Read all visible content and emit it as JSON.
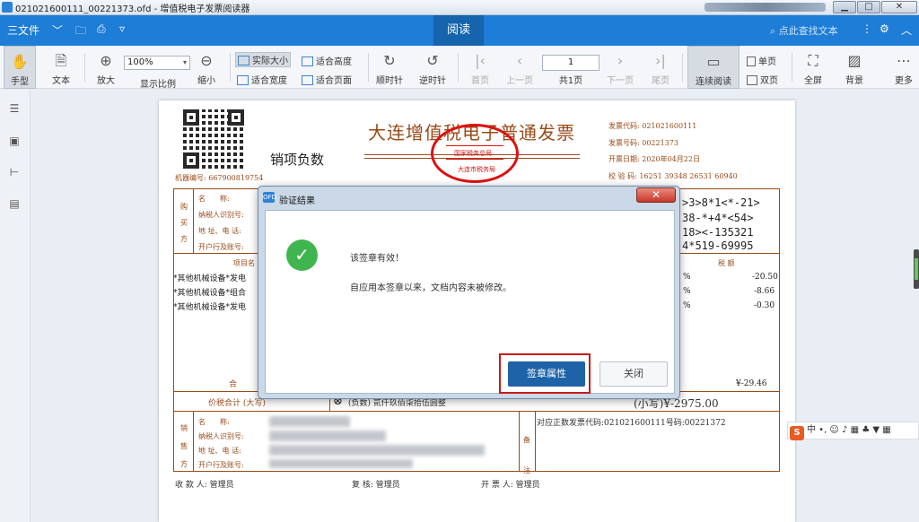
{
  "window": {
    "title": "021021600111_00221373.ofd - 增值税电子发票阅读器"
  },
  "menubar": {
    "file_label": "三文件",
    "read_tab": "阅读",
    "search_placeholder": "点此查找文本"
  },
  "toolbar": {
    "hand": "手型",
    "text": "文本",
    "zoom_in": "放大",
    "zoom_value": "100%",
    "display_ratio": "显示比例",
    "zoom_out": "缩小",
    "actual_size": "实际大小",
    "fit_height": "适合高度",
    "fit_width": "适合宽度",
    "fit_page": "适合页面",
    "rotate_cw": "顺时针",
    "rotate_ccw": "逆时针",
    "first_page": "首页",
    "prev_page": "上一页",
    "page_current": "1",
    "page_total": "共1页",
    "next_page": "下一页",
    "last_page": "尾页",
    "continuous": "连续阅读",
    "single_page": "单页",
    "double_page": "双页",
    "fullscreen": "全屏",
    "background": "背景",
    "more": "更多"
  },
  "invoice": {
    "title": "大连增值税电子普通发票",
    "sales_negative": "销项负数",
    "machine_no": "机器编号: 667900819754",
    "code_label": "发票代码: 021021600111",
    "number_label": "发票号码: 00221373",
    "date_label": "开票日期: 2020年04月22日",
    "check_label": "校 验 码: 16251 39348 26531 60940",
    "stamp_top": "国家税务总局",
    "stamp_bottom": "大连市税务局",
    "buyer_side": [
      "购",
      "买",
      "方"
    ],
    "buyer_fields": [
      "名　　称:",
      "纳税人识别号:",
      "地 址、电 话:",
      "开户行及账号:"
    ],
    "cipher": [
      ">3>8*1<*-21>",
      "38-*+4*<54>",
      "18><-135321",
      "4*519-69995"
    ],
    "item_header": "项目名",
    "items": [
      "*其他机械设备*发电",
      "*其他机械设备*组合",
      "*其他机械设备*发电"
    ],
    "tax_header": "税 额",
    "tax_values": [
      "-20.50",
      "-8.66",
      "-0.30"
    ],
    "total_label": "合",
    "total_tax": "¥-29.46",
    "price_total_label": "价税合计 (大写)",
    "price_total_words": "(负数) 贰仟玖佰柒拾伍圆整",
    "price_total_small": "(小写)¥-2975.00",
    "seller_side": [
      "销",
      "售",
      "方"
    ],
    "seller_fields": [
      "名　　称:",
      "纳税人识别号:",
      "地 址、电 话:",
      "开户行及账号:"
    ],
    "remark_side": [
      "备",
      "注"
    ],
    "remark": "对应正数发票代码:021021600111号码:00221372",
    "payee": "收 款 人: 管理员",
    "reviewer": "复 核: 管理员",
    "issuer": "开 票 人: 管理员"
  },
  "dialog": {
    "title": "验证结果",
    "message": "该签章有效！",
    "detail": "自应用本签章以来，文档内容未被修改。",
    "properties_button": "签章属性",
    "close_button": "关闭"
  },
  "ime": {
    "label": "中 •, ☺ ♪ ▦ ♣ ▼ ▦"
  }
}
